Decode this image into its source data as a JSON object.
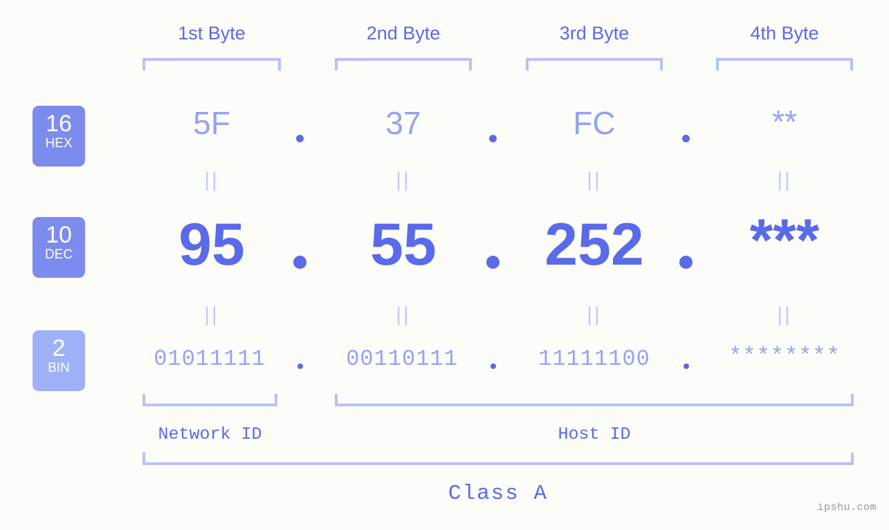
{
  "background_color": "#fcfdf9",
  "accent_color": "#5a6ae8",
  "accent_light_color": "#94a2f5",
  "bracket_color": "#b8c0fa",
  "byte_headers": [
    {
      "label": "1st Byte"
    },
    {
      "label": "2nd Byte"
    },
    {
      "label": "3rd Byte"
    },
    {
      "label": "4th Byte"
    }
  ],
  "bases": [
    {
      "number": "16",
      "name": "HEX",
      "color": "#7c8bee"
    },
    {
      "number": "10",
      "name": "DEC",
      "color": "#7c8bee"
    },
    {
      "number": "2",
      "name": "BIN",
      "color": "#9fb0f7"
    }
  ],
  "rows": {
    "hex": {
      "values": [
        "5F",
        "37",
        "FC",
        "**"
      ],
      "separator": "."
    },
    "dec": {
      "values": [
        "95",
        "55",
        "252",
        "***"
      ],
      "separator": "."
    },
    "bin": {
      "values": [
        "01011111",
        "00110111",
        "11111100",
        "********"
      ],
      "separator": "."
    }
  },
  "equivalence_marks": [
    "||",
    "||",
    "||",
    "||"
  ],
  "id_labels": {
    "network": "Network ID",
    "host": "Host ID"
  },
  "class_label": "Class A",
  "watermark": "ipshu.com"
}
